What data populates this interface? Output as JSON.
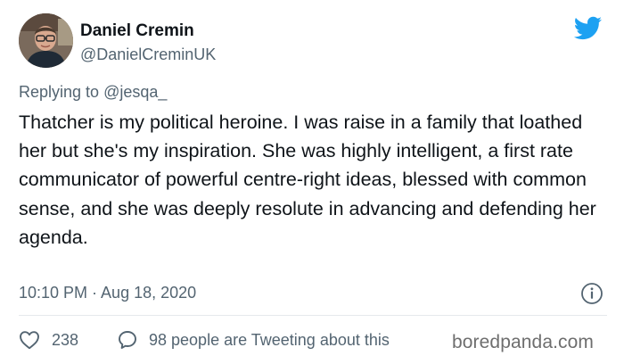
{
  "header": {
    "display_name": "Daniel Cremin",
    "handle": "@DanielCreminUK",
    "avatar_icon": "user-photo",
    "logo_icon": "twitter-bird-icon",
    "logo_color": "#1da1f2"
  },
  "reply_to": {
    "prefix": "Replying to",
    "mention": "@jesqa_"
  },
  "tweet": {
    "text": "Thatcher is my political heroine. I was raise in a family that loathed her but she's my inspiration. She was highly intelligent, a first rate communicator of powerful centre-right ideas, blessed with common sense, and she was deeply resolute in advancing and defending her agenda.",
    "timestamp": "10:10 PM · Aug 18, 2020"
  },
  "actions": {
    "likes": "238",
    "like_icon": "heart-icon",
    "discussion": "98 people are Tweeting about this",
    "discussion_icon": "speech-bubble-icon",
    "info_icon": "info-icon"
  },
  "watermark": "boredpanda.com"
}
